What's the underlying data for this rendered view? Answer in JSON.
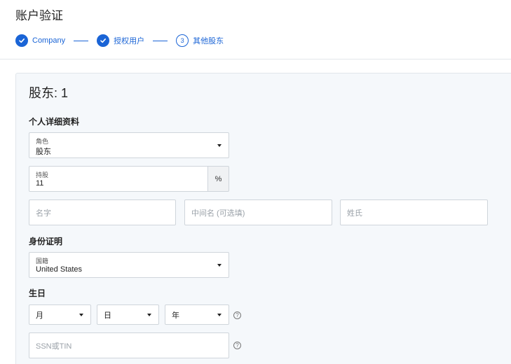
{
  "page": {
    "title": "账户验证"
  },
  "stepper": {
    "steps": [
      {
        "label": "Company",
        "state": "done"
      },
      {
        "label": "授权用户",
        "state": "done"
      },
      {
        "label": "其他股东",
        "state": "current",
        "number": "3"
      }
    ]
  },
  "form": {
    "shareholder_title": "股东: 1",
    "personal_section": "个人详细资料",
    "role": {
      "label": "角色",
      "value": "股东"
    },
    "ownership": {
      "label": "持股",
      "value": "11",
      "suffix": "%"
    },
    "first_name": {
      "placeholder": "名字"
    },
    "middle_name": {
      "placeholder": "中间名 (可选填)"
    },
    "last_name": {
      "placeholder": "姓氏"
    },
    "identity_section": "身份证明",
    "nationality": {
      "label": "国籍",
      "value": "United States"
    },
    "birthday_section": "生日",
    "birth_month": {
      "value": "月"
    },
    "birth_day": {
      "value": "日"
    },
    "birth_year": {
      "value": "年"
    },
    "ssn": {
      "placeholder": "SSN或TIN"
    },
    "help_glyph": "?"
  },
  "colors": {
    "accent": "#1a64d6",
    "card_bg": "#f5f8fb",
    "border": "#cfd5db"
  }
}
